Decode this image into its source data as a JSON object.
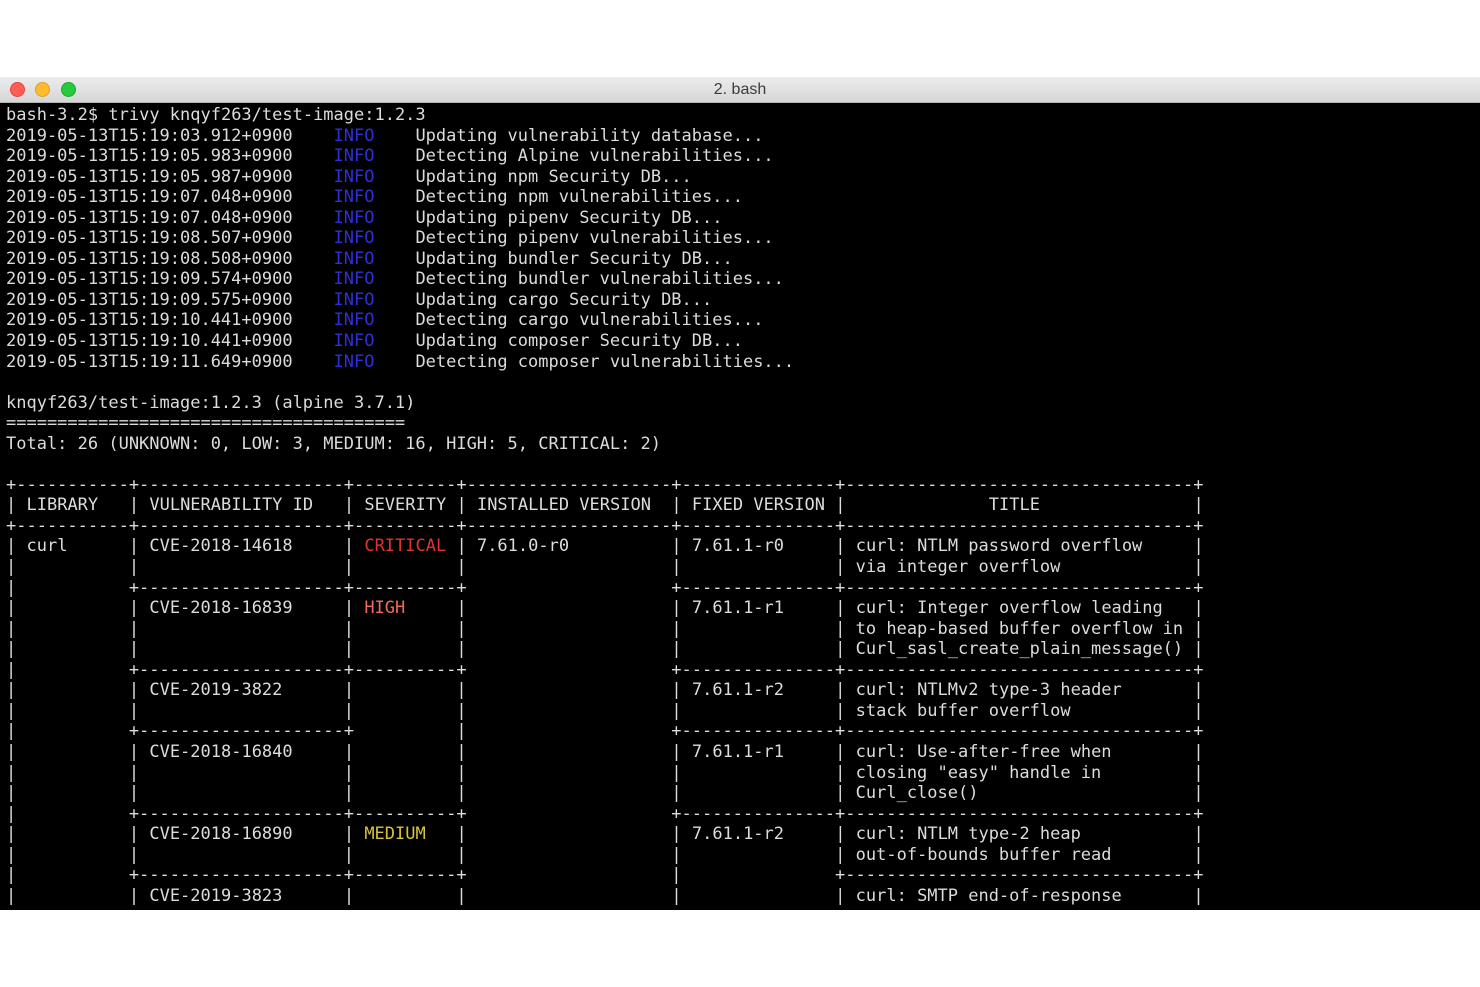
{
  "window": {
    "title": "2. bash"
  },
  "terminal": {
    "prompt": "bash-3.2$",
    "command": "trivy knqyf263/test-image:1.2.3",
    "logs": [
      {
        "ts": "2019-05-13T15:19:03.912+0900",
        "level": "INFO",
        "msg": "Updating vulnerability database..."
      },
      {
        "ts": "2019-05-13T15:19:05.983+0900",
        "level": "INFO",
        "msg": "Detecting Alpine vulnerabilities..."
      },
      {
        "ts": "2019-05-13T15:19:05.987+0900",
        "level": "INFO",
        "msg": "Updating npm Security DB..."
      },
      {
        "ts": "2019-05-13T15:19:07.048+0900",
        "level": "INFO",
        "msg": "Detecting npm vulnerabilities..."
      },
      {
        "ts": "2019-05-13T15:19:07.048+0900",
        "level": "INFO",
        "msg": "Updating pipenv Security DB..."
      },
      {
        "ts": "2019-05-13T15:19:08.507+0900",
        "level": "INFO",
        "msg": "Detecting pipenv vulnerabilities..."
      },
      {
        "ts": "2019-05-13T15:19:08.508+0900",
        "level": "INFO",
        "msg": "Updating bundler Security DB..."
      },
      {
        "ts": "2019-05-13T15:19:09.574+0900",
        "level": "INFO",
        "msg": "Detecting bundler vulnerabilities..."
      },
      {
        "ts": "2019-05-13T15:19:09.575+0900",
        "level": "INFO",
        "msg": "Updating cargo Security DB..."
      },
      {
        "ts": "2019-05-13T15:19:10.441+0900",
        "level": "INFO",
        "msg": "Detecting cargo vulnerabilities..."
      },
      {
        "ts": "2019-05-13T15:19:10.441+0900",
        "level": "INFO",
        "msg": "Updating composer Security DB..."
      },
      {
        "ts": "2019-05-13T15:19:11.649+0900",
        "level": "INFO",
        "msg": "Detecting composer vulnerabilities..."
      }
    ],
    "target": "knqyf263/test-image:1.2.3 (alpine 3.7.1)",
    "underline": "=======================================",
    "total": "Total: 26 (UNKNOWN: 0, LOW: 3, MEDIUM: 16, HIGH: 5, CRITICAL: 2)",
    "table": {
      "widths": [
        11,
        20,
        10,
        20,
        15,
        34
      ],
      "headers": [
        "LIBRARY",
        "VULNERABILITY ID",
        "SEVERITY",
        "INSTALLED VERSION",
        "FIXED VERSION",
        "TITLE"
      ],
      "rows": [
        {
          "library": "curl",
          "id": "CVE-2018-14618",
          "severity": "CRITICAL",
          "installed": "7.61.0-r0",
          "fixed": "7.61.1-r0",
          "title": [
            "curl: NTLM password overflow",
            "via integer overflow"
          ]
        },
        {
          "library": "",
          "id": "CVE-2018-16839",
          "severity": "HIGH",
          "installed": "",
          "fixed": "7.61.1-r1",
          "title": [
            "curl: Integer overflow leading",
            "to heap-based buffer overflow in",
            "Curl_sasl_create_plain_message()"
          ]
        },
        {
          "library": "",
          "id": "CVE-2019-3822",
          "severity": "",
          "installed": "",
          "fixed": "7.61.1-r2",
          "title": [
            "curl: NTLMv2 type-3 header",
            "stack buffer overflow"
          ]
        },
        {
          "library": "",
          "id": "CVE-2018-16840",
          "severity": "",
          "installed": "",
          "fixed": "7.61.1-r1",
          "title": [
            "curl: Use-after-free when",
            "closing \"easy\" handle in",
            "Curl_close()"
          ]
        },
        {
          "library": "",
          "id": "CVE-2018-16890",
          "severity": "MEDIUM",
          "installed": "",
          "fixed": "7.61.1-r2",
          "title": [
            "curl: NTLM type-2 heap",
            "out-of-bounds buffer read"
          ]
        },
        {
          "library": "",
          "id": "CVE-2019-3823",
          "severity": "",
          "installed": "",
          "fixed": "",
          "title": [
            "curl: SMTP end-of-response"
          ]
        }
      ]
    }
  },
  "colors": {
    "info": "#2f2fd8",
    "critical": "#e0352b",
    "high": "#ef6c5c",
    "medium": "#d8c43a"
  }
}
